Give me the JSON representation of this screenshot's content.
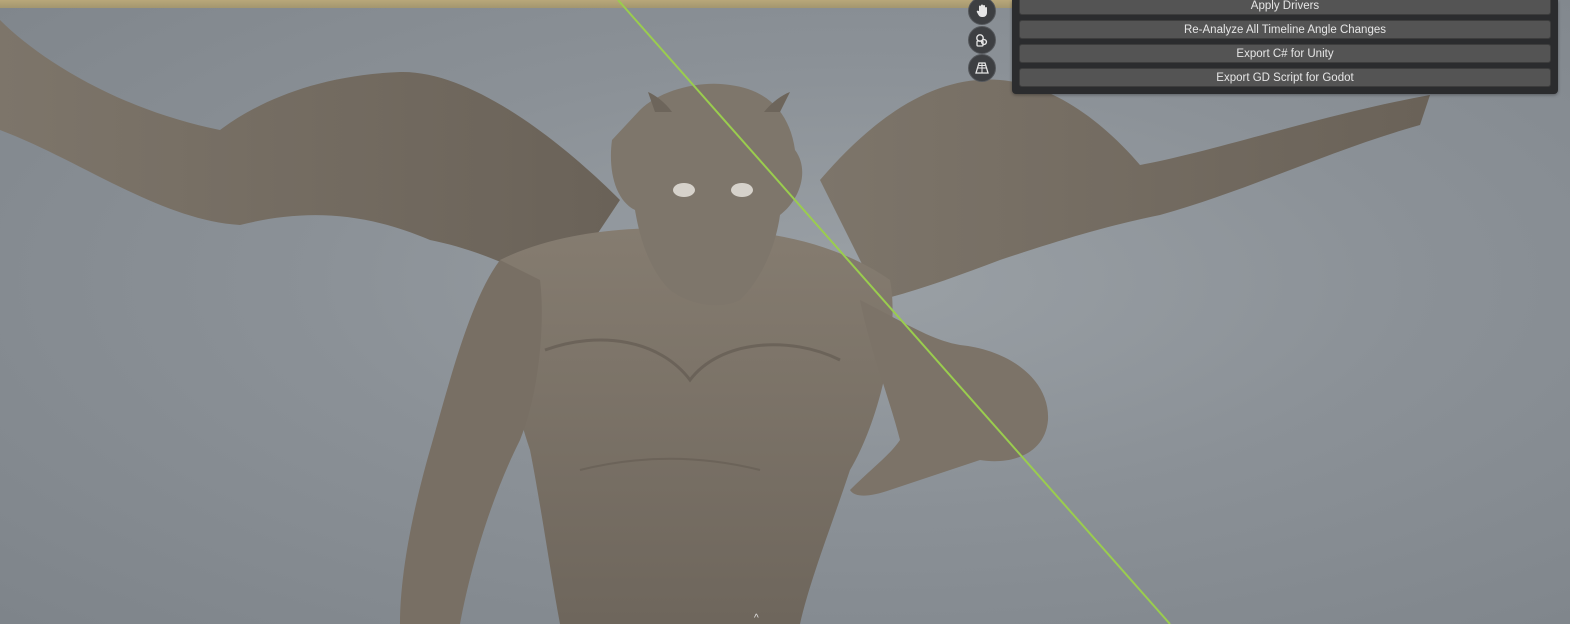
{
  "viewport": {
    "subject": "gargoyle-3d-model",
    "background_color": "#8b9197",
    "axis_line_color": "#9acd4e",
    "timeline_color": "#b8a77a"
  },
  "nav_gizmo": {
    "icons": [
      "hand-pan-icon",
      "camera-view-icon",
      "perspective-grid-icon"
    ]
  },
  "panel": {
    "buttons": [
      {
        "label": "Apply Drivers"
      },
      {
        "label": "Re-Analyze All Timeline Angle Changes"
      },
      {
        "label": "Export C# for Unity"
      },
      {
        "label": "Export GD Script for Godot"
      }
    ]
  }
}
